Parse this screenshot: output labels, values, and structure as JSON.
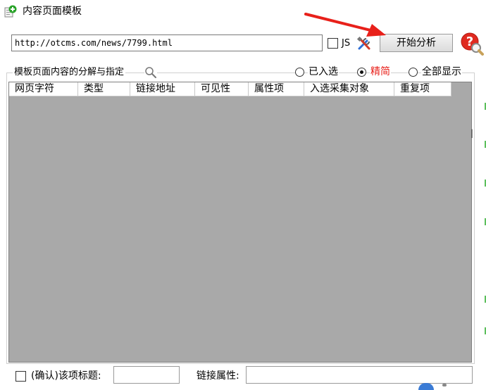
{
  "window": {
    "title": "内容页面模板"
  },
  "url_bar": {
    "value": "http://otcms.com/news/7799.html",
    "js_label": "JS",
    "js_checked": false,
    "start_button_label": "开始分析"
  },
  "group": {
    "label": "模板页面内容的分解与指定",
    "filters": [
      {
        "label": "已入选",
        "selected": false,
        "color": "#000000"
      },
      {
        "label": "精简",
        "selected": true,
        "color": "#e8201a"
      },
      {
        "label": "全部显示",
        "selected": false,
        "color": "#000000"
      }
    ]
  },
  "table": {
    "columns": [
      "网页字符",
      "类型",
      "链接地址",
      "可见性",
      "属性项",
      "入选采集对象",
      "重复项"
    ],
    "rows": []
  },
  "footer": {
    "confirm_label": "(确认)该项标题:",
    "confirm_checked": false,
    "title_value": "",
    "link_attr_label": "链接属性:",
    "link_attr_value": ""
  },
  "colors": {
    "annotation_arrow": "#e8201a",
    "table_background": "#a9a9a9",
    "selected_filter": "#e8201a"
  }
}
